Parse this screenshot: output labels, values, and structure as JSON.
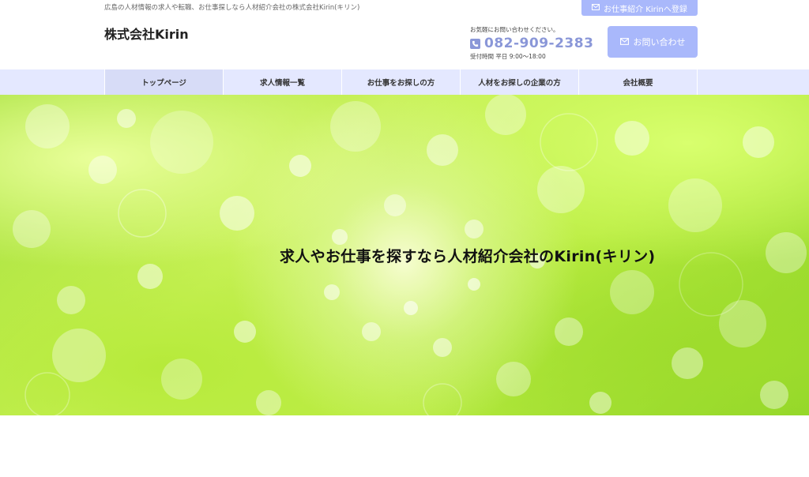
{
  "header": {
    "tagline": "広島の人材情報の求人や転職、お仕事探しなら人材紹介会社の株式会社Kirin(キリン)",
    "register_button": "お仕事紹介 Kirinへ登録",
    "site_title": "株式会社Kirin",
    "contact_note": "お気軽にお問い合わせください。",
    "tel": "082-909-2383",
    "hours": "受付時間 平日 9:00〜18:00",
    "contact_button": "お問い合わせ"
  },
  "nav": {
    "items": [
      {
        "label": "トップページ"
      },
      {
        "label": "求人情報一覧"
      },
      {
        "label": "お仕事をお探しの方"
      },
      {
        "label": "人材をお探しの企業の方"
      },
      {
        "label": "会社概要"
      }
    ]
  },
  "hero": {
    "headline": "求人やお仕事を探すなら人材紹介会社のKirin(キリン)"
  },
  "icons": {
    "mail": "mail-icon",
    "phone": "phone-icon"
  },
  "colors": {
    "accent": "#a9b8fb",
    "tel": "#8a97d8",
    "nav_bg": "#e4e8ff"
  }
}
